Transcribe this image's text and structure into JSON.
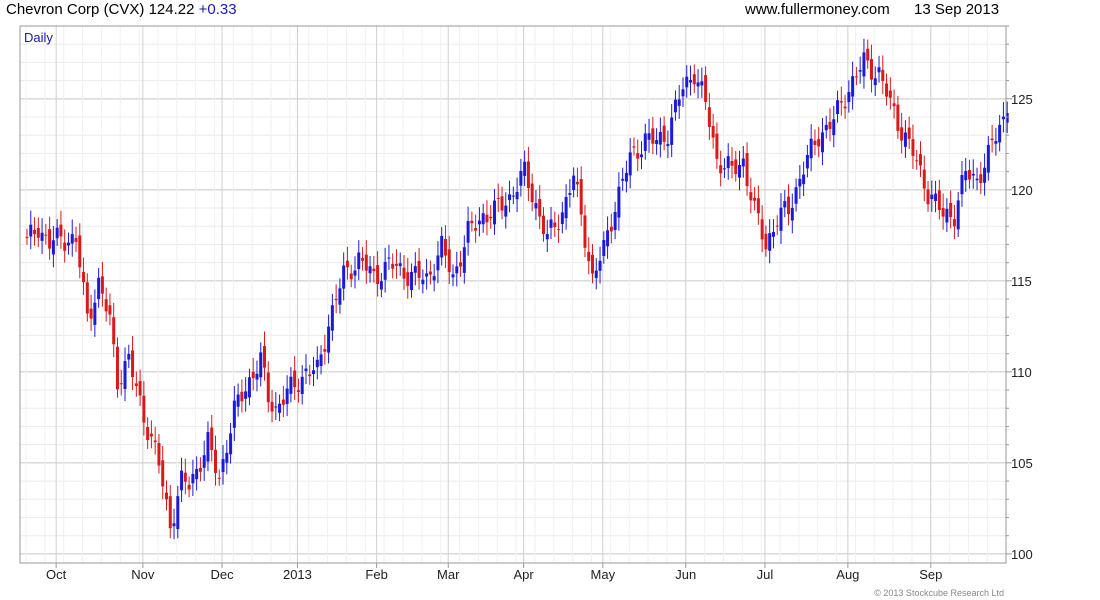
{
  "header": {
    "company": "Chevron Corp",
    "ticker": "(CVX)",
    "price": "124.22",
    "change": "+0.33",
    "site": "www.fullermoney.com",
    "date": "13 Sep 2013"
  },
  "footer": {
    "copyright": "© 2013 Stockcube Research Ltd"
  },
  "colors": {
    "up": "#1a1ad8",
    "down": "#d81a1a",
    "grid": "#d4d4d4",
    "frame": "#9a9a9a",
    "period": "#1a1aa8"
  },
  "chart_data": {
    "type": "candlestick",
    "period_label": "Daily",
    "ylim": [
      99.5,
      129.0
    ],
    "y_ticks": [
      100,
      105,
      110,
      115,
      120,
      125
    ],
    "x_ticks": [
      {
        "label": "Oct",
        "index": 8
      },
      {
        "label": "Nov",
        "index": 31
      },
      {
        "label": "Dec",
        "index": 52
      },
      {
        "label": "2013",
        "index": 72
      },
      {
        "label": "Feb",
        "index": 93
      },
      {
        "label": "Mar",
        "index": 112
      },
      {
        "label": "Apr",
        "index": 132
      },
      {
        "label": "May",
        "index": 153
      },
      {
        "label": "Jun",
        "index": 175
      },
      {
        "label": "Jul",
        "index": 196
      },
      {
        "label": "Aug",
        "index": 218
      },
      {
        "label": "Sep",
        "index": 240
      }
    ],
    "anchors": [
      [
        0,
        117.1
      ],
      [
        3,
        118.0
      ],
      [
        6,
        117.0
      ],
      [
        9,
        117.4
      ],
      [
        13,
        117.2
      ],
      [
        16,
        113.0
      ],
      [
        19,
        114.8
      ],
      [
        22,
        112.8
      ],
      [
        24,
        109.6
      ],
      [
        27,
        110.6
      ],
      [
        31,
        107.6
      ],
      [
        35,
        104.9
      ],
      [
        38,
        101.6
      ],
      [
        41,
        103.9
      ],
      [
        43,
        103.8
      ],
      [
        48,
        106.0
      ],
      [
        51,
        104.2
      ],
      [
        55,
        107.8
      ],
      [
        58,
        109.2
      ],
      [
        62,
        110.6
      ],
      [
        64,
        108.6
      ],
      [
        66,
        108.0
      ],
      [
        69,
        108.8
      ],
      [
        74,
        110.0
      ],
      [
        77,
        110.0
      ],
      [
        80,
        112.7
      ],
      [
        84,
        115.3
      ],
      [
        88,
        116.2
      ],
      [
        92,
        115.2
      ],
      [
        96,
        115.9
      ],
      [
        102,
        115.3
      ],
      [
        106,
        115.1
      ],
      [
        110,
        116.8
      ],
      [
        113,
        115.2
      ],
      [
        117,
        117.6
      ],
      [
        121,
        118.6
      ],
      [
        124,
        118.8
      ],
      [
        128,
        119.6
      ],
      [
        132,
        120.9
      ],
      [
        134,
        119.8
      ],
      [
        138,
        117.3
      ],
      [
        142,
        118.8
      ],
      [
        145,
        120.7
      ],
      [
        148,
        117.5
      ],
      [
        150,
        115.1
      ],
      [
        153,
        116.7
      ],
      [
        156,
        119.2
      ],
      [
        160,
        121.7
      ],
      [
        164,
        122.8
      ],
      [
        167,
        122.6
      ],
      [
        170,
        123.2
      ],
      [
        174,
        125.6
      ],
      [
        177,
        126.5
      ],
      [
        180,
        124.7
      ],
      [
        183,
        121.7
      ],
      [
        187,
        121.0
      ],
      [
        190,
        121.6
      ],
      [
        193,
        118.8
      ],
      [
        196,
        117.0
      ],
      [
        199,
        118.4
      ],
      [
        202,
        118.9
      ],
      [
        206,
        121.2
      ],
      [
        210,
        123.0
      ],
      [
        214,
        123.8
      ],
      [
        218,
        125.6
      ],
      [
        222,
        127.0
      ],
      [
        226,
        126.4
      ],
      [
        229,
        124.7
      ],
      [
        232,
        123.3
      ],
      [
        235,
        122.0
      ],
      [
        239,
        119.9
      ],
      [
        243,
        118.6
      ],
      [
        246,
        118.7
      ],
      [
        249,
        120.9
      ],
      [
        252,
        120.6
      ],
      [
        255,
        121.8
      ],
      [
        258,
        123.6
      ],
      [
        260,
        124.2
      ]
    ],
    "last_close": 124.22
  }
}
